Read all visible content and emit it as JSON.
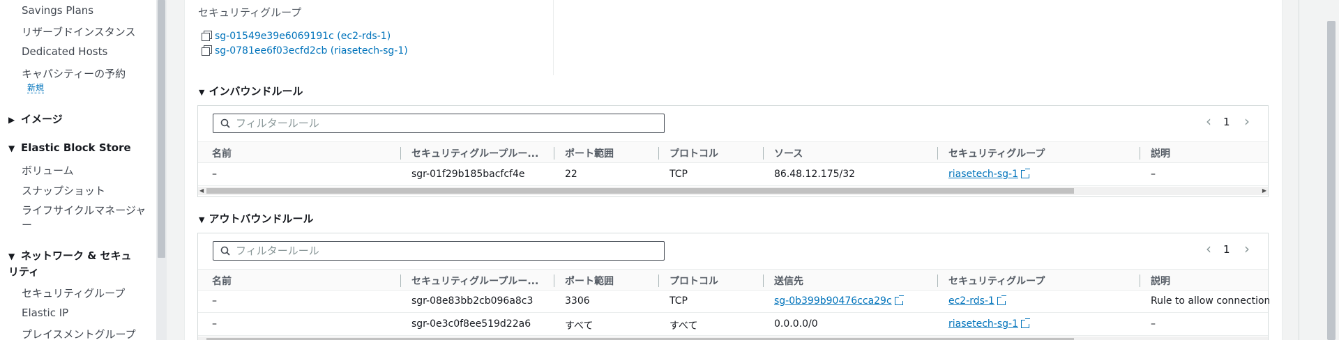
{
  "sidebar": {
    "items": [
      {
        "label": "Savings Plans"
      },
      {
        "label": "リザーブドインスタンス"
      },
      {
        "label": "Dedicated Hosts"
      },
      {
        "label": "キャパシティーの予約"
      }
    ],
    "new_badge": "新規",
    "images_heading": "イメージ",
    "ebs_heading": "Elastic Block Store",
    "ebs_items": [
      "ボリューム",
      "スナップショット",
      "ライフサイクルマネージャー"
    ],
    "network_heading": "ネットワーク & セキュリティ",
    "network_items": [
      "セキュリティグループ",
      "Elastic IP",
      "プレイスメントグループ"
    ]
  },
  "details": {
    "sg_label": "セキュリティグループ",
    "sg_links": [
      "sg-01549e39e6069191c (ec2-rds-1)",
      "sg-0781ee6f03ecfd2cb (riasetech-sg-1)"
    ]
  },
  "inbound": {
    "title": "インバウンドルール",
    "filter_placeholder": "フィルタールール",
    "page": "1",
    "columns": [
      "名前",
      "セキュリティグループルー...",
      "ポート範囲",
      "プロトコル",
      "ソース",
      "セキュリティグループ",
      "説明"
    ],
    "rows": [
      {
        "name": "–",
        "rule_id": "sgr-01f29b185bacfcf4e",
        "port": "22",
        "protocol": "TCP",
        "source": "86.48.12.175/32",
        "sg": "riasetech-sg-1",
        "desc": "–"
      }
    ]
  },
  "outbound": {
    "title": "アウトバウンドルール",
    "filter_placeholder": "フィルタールール",
    "page": "1",
    "columns": [
      "名前",
      "セキュリティグループルー...",
      "ポート範囲",
      "プロトコル",
      "送信先",
      "セキュリティグループ",
      "説明"
    ],
    "rows": [
      {
        "name": "–",
        "rule_id": "sgr-08e83bb2cb096a8c3",
        "port": "3306",
        "protocol": "TCP",
        "dest": "sg-0b399b90476cca29c",
        "sg": "ec2-rds-1",
        "desc": "Rule to allow connections to"
      },
      {
        "name": "–",
        "rule_id": "sgr-0e3c0f8ee519d22a6",
        "port": "すべて",
        "protocol": "すべて",
        "dest": "0.0.0.0/0",
        "sg": "riasetech-sg-1",
        "desc": "–"
      }
    ]
  },
  "colors": {
    "link": "#0073bb",
    "text": "#16191f",
    "muted": "#545b64"
  }
}
